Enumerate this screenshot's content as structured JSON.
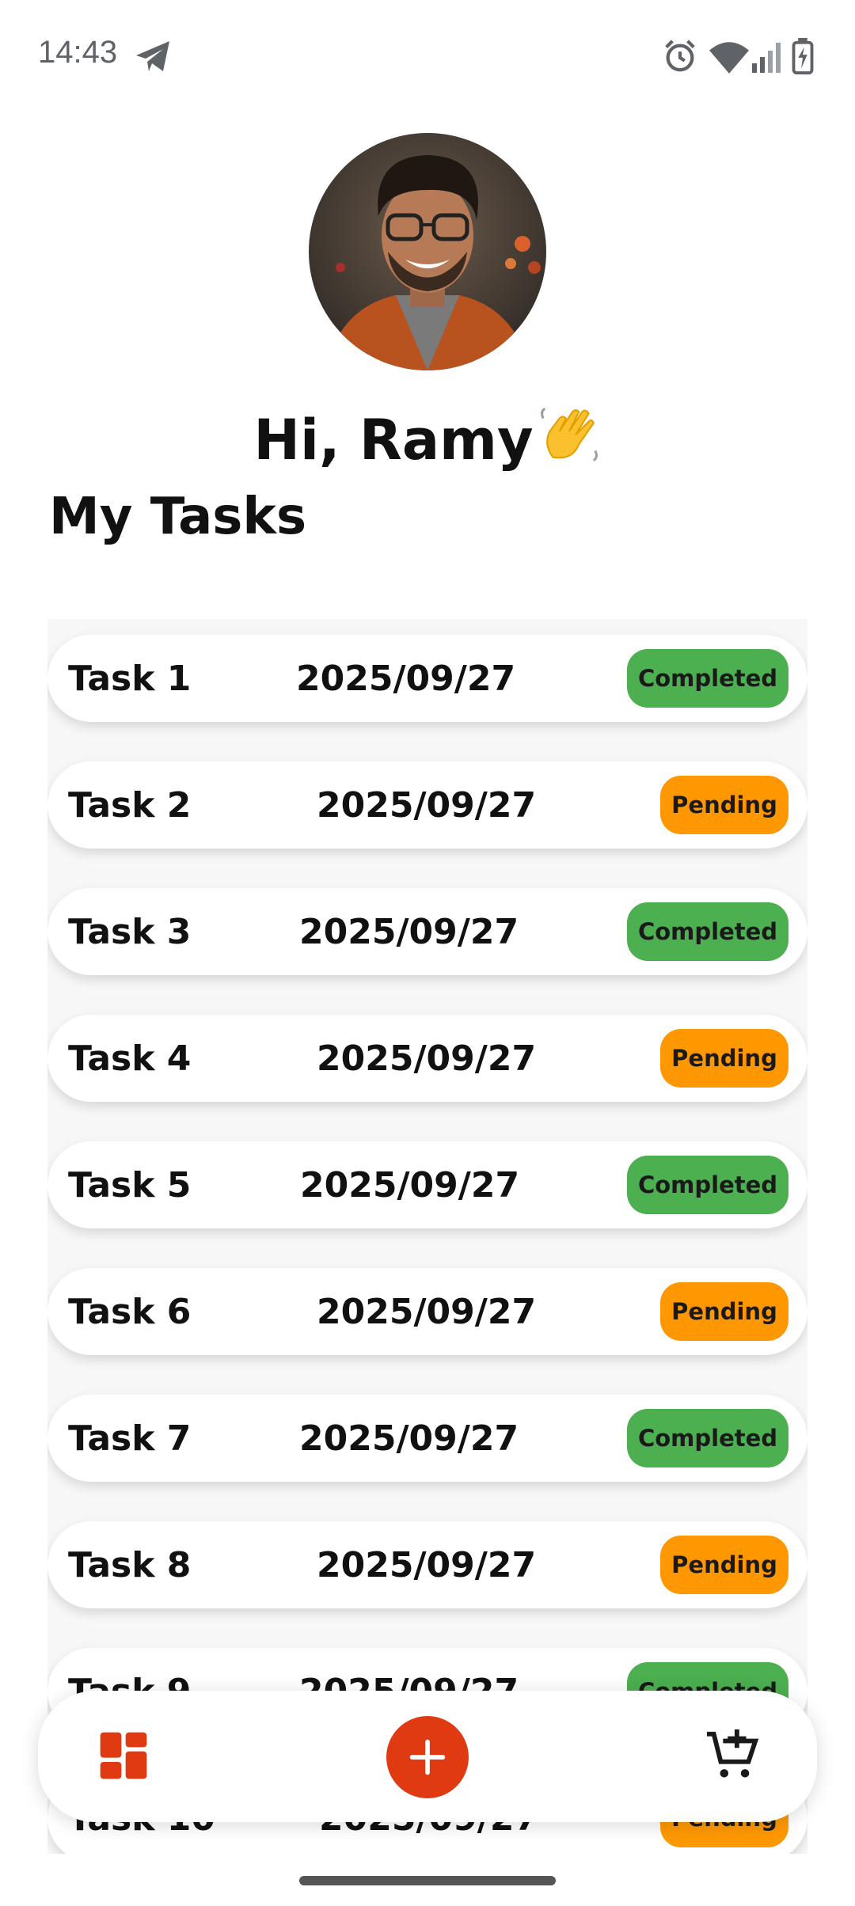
{
  "status_bar": {
    "time": "14:43",
    "icons": [
      "telegram-icon",
      "alarm-icon",
      "wifi-icon",
      "signal-icon",
      "battery-charging-icon"
    ]
  },
  "profile": {
    "greeting": "Hi, Ramy",
    "avatar": "profile-photo"
  },
  "section_title": "My Tasks",
  "tasks": [
    {
      "name": "Task 1",
      "date": "2025/09/27",
      "status": "Completed"
    },
    {
      "name": "Task 2",
      "date": "2025/09/27",
      "status": "Pending"
    },
    {
      "name": "Task 3",
      "date": "2025/09/27",
      "status": "Completed"
    },
    {
      "name": "Task 4",
      "date": "2025/09/27",
      "status": "Pending"
    },
    {
      "name": "Task 5",
      "date": "2025/09/27",
      "status": "Completed"
    },
    {
      "name": "Task 6",
      "date": "2025/09/27",
      "status": "Pending"
    },
    {
      "name": "Task 7",
      "date": "2025/09/27",
      "status": "Completed"
    },
    {
      "name": "Task 8",
      "date": "2025/09/27",
      "status": "Pending"
    },
    {
      "name": "Task 9",
      "date": "2025/09/27",
      "status": "Completed"
    },
    {
      "name": "Task 10",
      "date": "2025/09/27",
      "status": "Pending"
    }
  ],
  "colors": {
    "completed": "#4caf50",
    "pending": "#ff9800",
    "accent": "#e03a12"
  },
  "bottom_nav": {
    "items": [
      "dashboard-icon",
      "add-icon",
      "add-to-cart-icon"
    ]
  }
}
